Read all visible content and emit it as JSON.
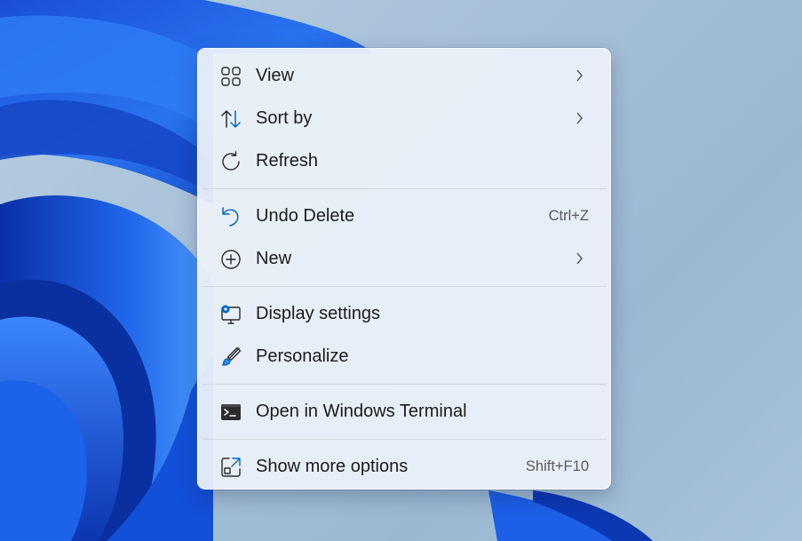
{
  "menu": {
    "items": {
      "view": {
        "label": "View",
        "icon": "view-grid-icon"
      },
      "sort_by": {
        "label": "Sort by",
        "icon": "sort-arrows-icon"
      },
      "refresh": {
        "label": "Refresh",
        "icon": "refresh-icon"
      },
      "undo_delete": {
        "label": "Undo Delete",
        "shortcut": "Ctrl+Z",
        "icon": "undo-icon"
      },
      "new": {
        "label": "New",
        "icon": "add-circle-icon"
      },
      "display_settings": {
        "label": "Display settings",
        "icon": "display-settings-icon"
      },
      "personalize": {
        "label": "Personalize",
        "icon": "brush-icon"
      },
      "terminal": {
        "label": "Open in Windows Terminal",
        "icon": "terminal-icon"
      },
      "more_options": {
        "label": "Show more options",
        "shortcut": "Shift+F10",
        "icon": "open-external-icon"
      }
    }
  },
  "colors": {
    "accent": "#0067c0",
    "wallpaper_blue": "#1e5ee6",
    "menu_bg": "#ecf1f9"
  }
}
